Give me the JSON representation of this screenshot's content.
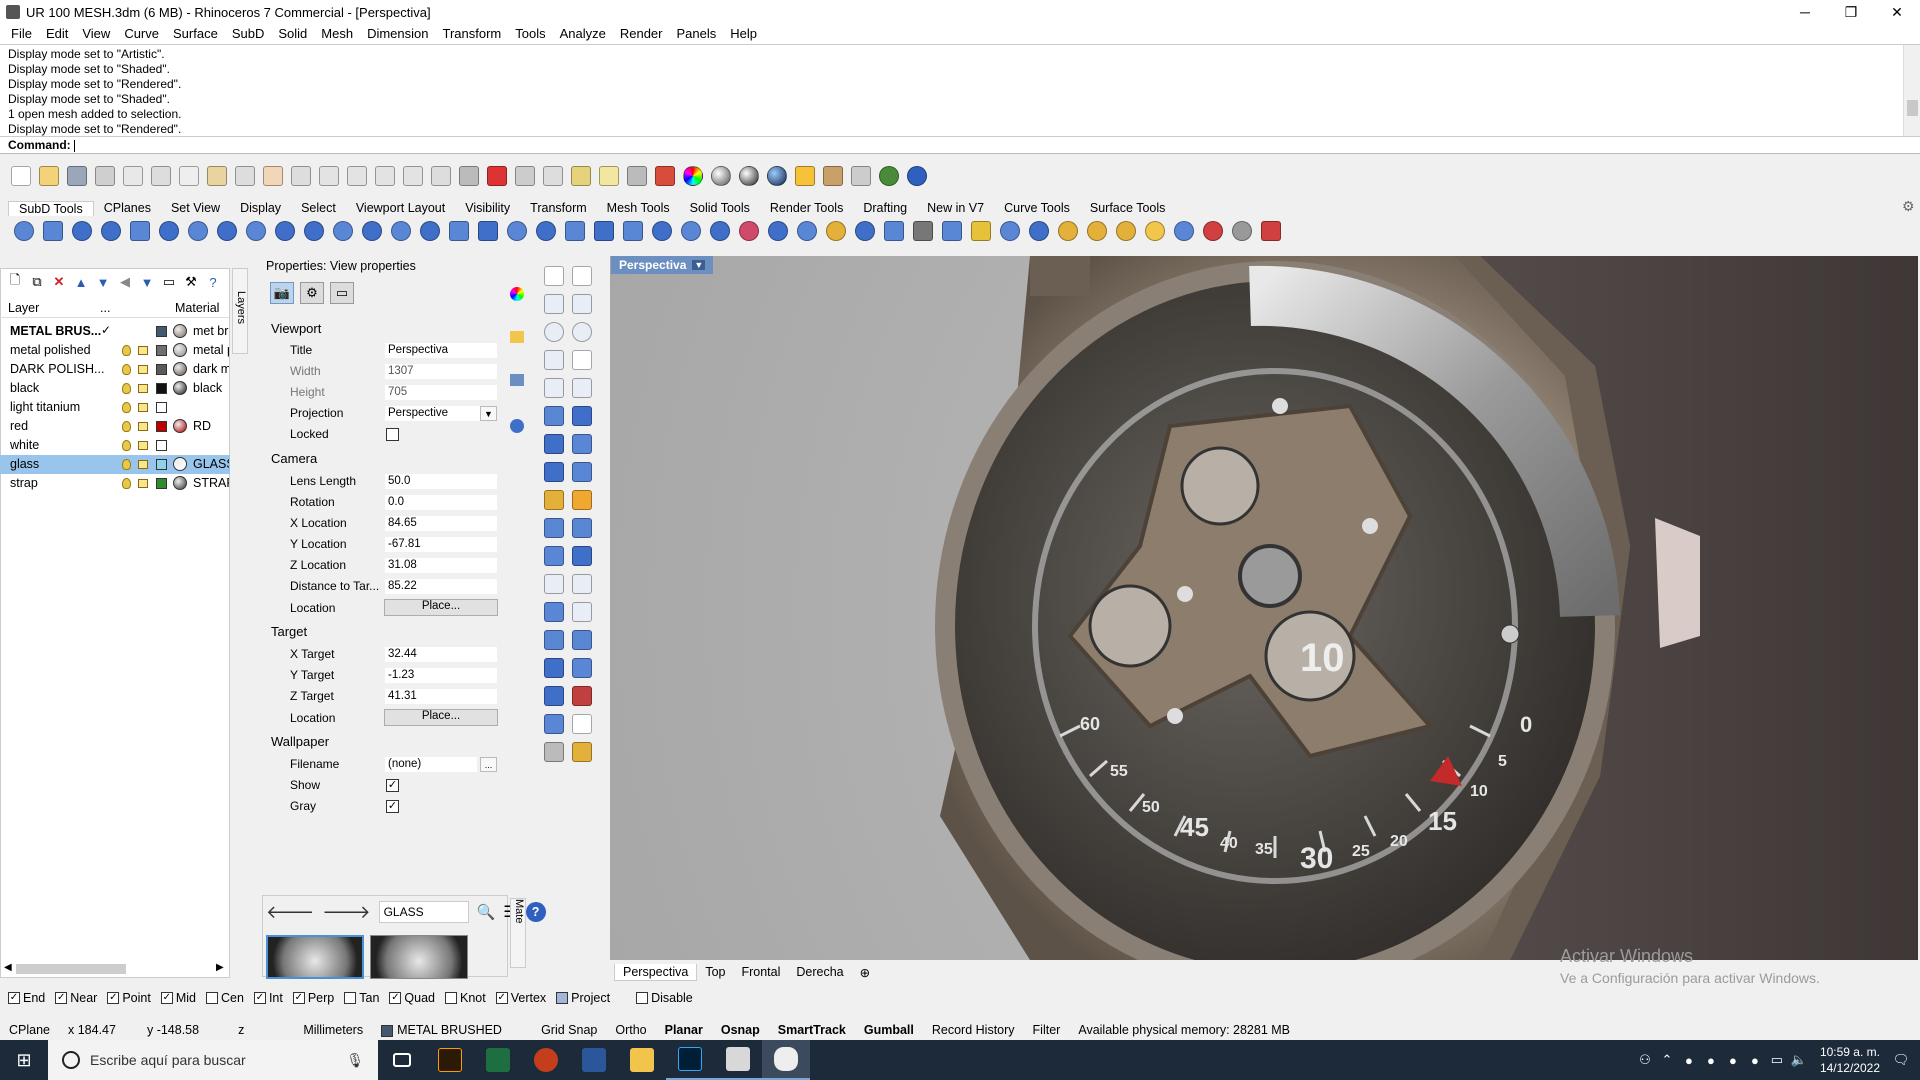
{
  "window": {
    "title": "UR 100 MESH.3dm (6 MB) - Rhinoceros 7 Commercial - [Perspectiva]",
    "minimize": "─",
    "maximize": "❐",
    "close": "✕"
  },
  "menu": [
    "File",
    "Edit",
    "View",
    "Curve",
    "Surface",
    "SubD",
    "Solid",
    "Mesh",
    "Dimension",
    "Transform",
    "Tools",
    "Analyze",
    "Render",
    "Panels",
    "Help"
  ],
  "history": [
    "Display mode set to \"Artistic\".",
    "Display mode set to \"Shaded\".",
    "Display mode set to \"Rendered\".",
    "Display mode set to \"Shaded\".",
    "1 open mesh added to selection.",
    "Display mode set to \"Rendered\"."
  ],
  "command": {
    "label": "Command:"
  },
  "toolbar_tabs": [
    "SubD Tools",
    "CPlanes",
    "Set View",
    "Display",
    "Select",
    "Viewport Layout",
    "Visibility",
    "Transform",
    "Mesh Tools",
    "Solid Tools",
    "Render Tools",
    "Drafting",
    "New in V7",
    "Curve Tools",
    "Surface Tools"
  ],
  "layers": {
    "header_layer": "Layer",
    "header_dots": "...",
    "header_material": "Material",
    "vertical_tab": "Layers",
    "rows": [
      {
        "name": "METAL BRUS...",
        "current": "✓",
        "color": "#44596f",
        "mat_color": "#7a6f62",
        "material": "met br",
        "bold": true,
        "selected": false
      },
      {
        "name": "metal polished",
        "current": "",
        "color": "#6f6f6f",
        "mat_color": "#8c8c8c",
        "material": "metal p",
        "bold": false,
        "selected": false
      },
      {
        "name": "DARK POLISH...",
        "current": "",
        "color": "#5a5a5a",
        "mat_color": "#5b5048",
        "material": "dark m",
        "bold": false,
        "selected": false
      },
      {
        "name": "black",
        "current": "",
        "color": "#111111",
        "mat_color": "#1a1a1a",
        "material": "black",
        "bold": false,
        "selected": false
      },
      {
        "name": "light titanium",
        "current": "",
        "color": "#ffffff",
        "mat_color": "",
        "material": "",
        "bold": false,
        "selected": false
      },
      {
        "name": "red",
        "current": "",
        "color": "#c00000",
        "mat_color": "#b00000",
        "material": "RD",
        "bold": false,
        "selected": false
      },
      {
        "name": "white",
        "current": "",
        "color": "#ffffff",
        "mat_color": "",
        "material": "",
        "bold": false,
        "selected": false
      },
      {
        "name": "glass",
        "current": "",
        "color": "#8fd3e8",
        "mat_color": "#ffffff",
        "material": "GLASS",
        "bold": false,
        "selected": true
      },
      {
        "name": "strap",
        "current": "",
        "color": "#2e8b2e",
        "mat_color": "#333333",
        "material": "STRAP",
        "bold": false,
        "selected": false
      }
    ]
  },
  "properties": {
    "title": "Properties: View properties",
    "viewport_section": "Viewport",
    "title_label": "Title",
    "title_value": "Perspectiva",
    "width_label": "Width",
    "width_value": "1307",
    "height_label": "Height",
    "height_value": "705",
    "projection_label": "Projection",
    "projection_value": "Perspective",
    "locked_label": "Locked",
    "camera_section": "Camera",
    "lens_label": "Lens Length",
    "lens_value": "50.0",
    "rotation_label": "Rotation",
    "rotation_value": "0.0",
    "xloc_label": "X Location",
    "xloc_value": "84.65",
    "yloc_label": "Y Location",
    "yloc_value": "-67.81",
    "zloc_label": "Z Location",
    "zloc_value": "31.08",
    "dist_label": "Distance to Tar...",
    "dist_value": "85.22",
    "location_label": "Location",
    "place_button": "Place...",
    "target_section": "Target",
    "xt_label": "X Target",
    "xt_value": "32.44",
    "yt_label": "Y Target",
    "yt_value": "-1.23",
    "zt_label": "Z Target",
    "zt_value": "41.31",
    "tloc_label": "Location",
    "tplace_button": "Place...",
    "wallpaper_section": "Wallpaper",
    "filename_label": "Filename",
    "filename_value": "(none)",
    "browse": "...",
    "show_label": "Show",
    "show_checked": "✓",
    "gray_label": "Gray",
    "gray_checked": "✓"
  },
  "materials": {
    "search_value": "GLASS",
    "vertical_tab": "Mate"
  },
  "viewport": {
    "tab_label": "Perspectiva",
    "watermark_title": "Activar Windows",
    "watermark_sub": "Ve a Configuración para activar Windows.",
    "watch_numbers": [
      "60",
      "55",
      "50",
      "45",
      "40",
      "35",
      "30",
      "25",
      "20",
      "15",
      "10",
      "5",
      "0"
    ]
  },
  "viewport_tabs": [
    "Perspectiva",
    "Top",
    "Frontal",
    "Derecha"
  ],
  "viewport_tab_add": "⊕",
  "osnaps": [
    {
      "label": "End",
      "checked": true
    },
    {
      "label": "Near",
      "checked": true
    },
    {
      "label": "Point",
      "checked": true
    },
    {
      "label": "Mid",
      "checked": true
    },
    {
      "label": "Cen",
      "checked": false
    },
    {
      "label": "Int",
      "checked": true
    },
    {
      "label": "Perp",
      "checked": true
    },
    {
      "label": "Tan",
      "checked": false
    },
    {
      "label": "Quad",
      "checked": true
    },
    {
      "label": "Knot",
      "checked": false
    },
    {
      "label": "Vertex",
      "checked": true
    },
    {
      "label": "Project",
      "checked": false,
      "blue": true
    },
    {
      "label": "Disable",
      "checked": false
    }
  ],
  "status": {
    "cplane": "CPlane",
    "x": "x 184.47",
    "y": "y -148.58",
    "z": "z",
    "units": "Millimeters",
    "layer": "METAL BRUSHED",
    "grid_snap": "Grid Snap",
    "ortho": "Ortho",
    "planar": "Planar",
    "osnap": "Osnap",
    "smarttrack": "SmartTrack",
    "gumball": "Gumball",
    "record_history": "Record History",
    "filter": "Filter",
    "memory": "Available physical memory: 28281 MB"
  },
  "taskbar": {
    "search_placeholder": "Escribe aquí para buscar",
    "time": "10:59 a. m.",
    "date": "14/12/2022"
  },
  "colors": {
    "accent": "#6b8fc1",
    "selection": "#99c5ec"
  }
}
